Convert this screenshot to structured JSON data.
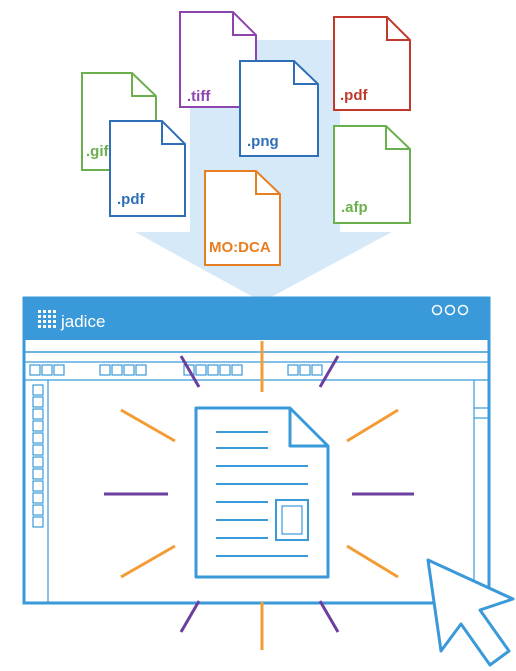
{
  "app": {
    "brand": "jadice",
    "window_controls": [
      "minimize",
      "maximize",
      "close"
    ],
    "toolbar_groups": [
      3,
      4,
      5,
      3
    ],
    "side_buttons": 12
  },
  "files": [
    {
      "label": ".gif",
      "color": "#6ab04c"
    },
    {
      "label": ".tiff",
      "color": "#8e44ad"
    },
    {
      "label": ".pdf",
      "color": "#c0392b"
    },
    {
      "label": ".png",
      "color": "#2f6fb8"
    },
    {
      "label": ".pdf",
      "color": "#2f6fb8"
    },
    {
      "label": ".afp",
      "color": "#6ab04c"
    },
    {
      "label": "MO:DCA",
      "color": "#e67e22"
    }
  ],
  "colors": {
    "window_blue": "#3a9ad9",
    "arrow": "#d6e9f8",
    "ray_orange": "#f39c35",
    "ray_purple": "#6b3fa0"
  },
  "icons": [
    "down-arrow-icon",
    "document-icon",
    "cursor-icon",
    "grid-logo-icon"
  ]
}
